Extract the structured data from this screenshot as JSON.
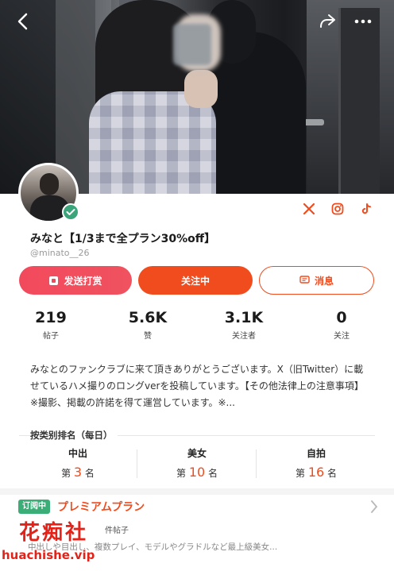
{
  "profile": {
    "name": "みなと【1/3まで全プラン30%off】",
    "handle": "@minato__26",
    "verified": true
  },
  "actions": {
    "tip_label": "发送打赏",
    "follow_label": "关注中",
    "message_label": "消息"
  },
  "stats": [
    {
      "value": "219",
      "label": "帖子"
    },
    {
      "value": "5.6K",
      "label": "赞"
    },
    {
      "value": "3.1K",
      "label": "关注者"
    },
    {
      "value": "0",
      "label": "关注"
    }
  ],
  "bio": "みなとのファンクラブに来て頂きありがとうございます。X（旧Twitter）に載せているハメ撮りのロングverを投稿しています。【その他法律上の注意事項】※撮影、掲載の許諾を得て運営しています。※...",
  "ranking": {
    "title": "按类别排名（每日）",
    "items": [
      {
        "category": "中出",
        "prefix": "第",
        "rank": "3",
        "suffix": "名"
      },
      {
        "category": "美女",
        "prefix": "第",
        "rank": "10",
        "suffix": "名"
      },
      {
        "category": "自拍",
        "prefix": "第",
        "rank": "16",
        "suffix": "名"
      }
    ]
  },
  "plan": {
    "badge": "订阅中",
    "name": "プレミアムプラン",
    "count_text": "件帖子",
    "description": "中出しや目出し、複数プレイ、モデルやグラドルなど最上級美女..."
  },
  "watermark": {
    "brand": "花痴社",
    "url": "huachishe.vip"
  },
  "colors": {
    "accent": "#f04c1e",
    "tip": "#f24a5d",
    "subscribed": "#3bae77",
    "watermark": "#e2231a"
  },
  "icons": {
    "back": "chevron-left-icon",
    "share": "share-icon",
    "more": "more-horizontal-icon",
    "x": "x-logo-icon",
    "instagram": "instagram-icon",
    "tiktok": "tiktok-icon"
  }
}
